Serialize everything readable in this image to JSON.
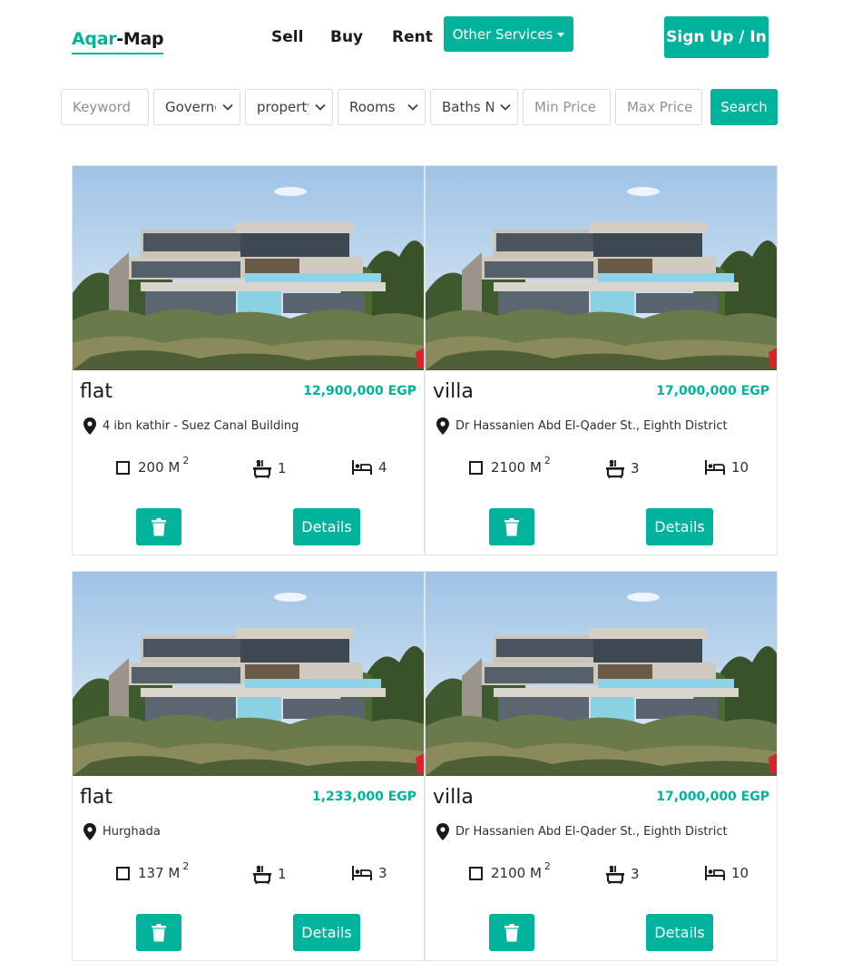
{
  "header": {
    "logo_part1": "Aqar",
    "logo_part2": "-Map",
    "nav": [
      "Sell",
      "Buy",
      "Rent"
    ],
    "other_services": "Other Services",
    "signup": "Sign Up / In"
  },
  "filters": {
    "keyword_placeholder": "Keyword",
    "governorate": "Governorate",
    "property_type": "property type",
    "rooms": "Rooms",
    "baths": "Baths Number",
    "min_price_placeholder": "Min Price",
    "max_price_placeholder": "Max Price",
    "search": "Search"
  },
  "listings": [
    {
      "type": "flat",
      "price": "12,900,000 EGP",
      "location": "4 ibn kathir - Suez Canal Building",
      "area": "200 M",
      "area_sup": "2",
      "baths": "1",
      "rooms": "4",
      "details": "Details"
    },
    {
      "type": "villa",
      "price": "17,000,000 EGP",
      "location": "Dr Hassanien Abd El-Qader St., Eighth District",
      "area": "2100 M",
      "area_sup": "2",
      "baths": "3",
      "rooms": "10",
      "details": "Details"
    },
    {
      "type": "flat",
      "price": "1,233,000 EGP",
      "location": "Hurghada",
      "area": "137 M",
      "area_sup": "2",
      "baths": "1",
      "rooms": "3",
      "details": "Details"
    },
    {
      "type": "villa",
      "price": "17,000,000 EGP",
      "location": "Dr Hassanien Abd El-Qader St., Eighth District",
      "area": "2100 M",
      "area_sup": "2",
      "baths": "3",
      "rooms": "10",
      "details": "Details"
    }
  ],
  "colors": {
    "accent": "#00b39c",
    "text": "#1a1a1a",
    "border": "#e2e4e7"
  },
  "icons": [
    "map-pin-icon",
    "area-square-icon",
    "bathtub-icon",
    "bed-icon",
    "trash-icon",
    "chevron-down-icon"
  ]
}
